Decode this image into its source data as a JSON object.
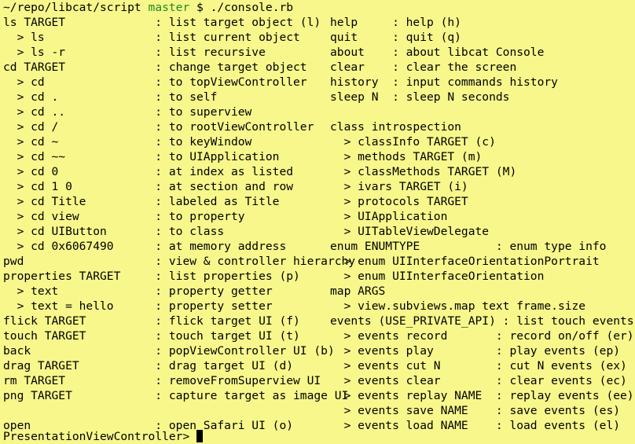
{
  "header": {
    "path": "~/repo/libcat/script",
    "branch": "master",
    "command": "$ ./console.rb"
  },
  "left": {
    "l1": "ls TARGET             : list target object (l)",
    "l2": "  > ls                : list current object",
    "l3": "  > ls -r             : list recursive",
    "l4": "cd TARGET             : change target object",
    "l5": "  > cd                : to topViewController",
    "l6": "  > cd .              : to self",
    "l7": "  > cd ..             : to superview",
    "l8": "  > cd /              : to rootViewController",
    "l9": "  > cd ~              : to keyWindow",
    "l10": "  > cd ~~             : to UIApplication",
    "l11": "  > cd 0              : at index as listed",
    "l12": "  > cd 1 0            : at section and row",
    "l13": "  > cd Title          : labeled as Title",
    "l14": "  > cd view           : to property",
    "l15": "  > cd UIButton       : to class",
    "l16": "  > cd 0x6067490      : at memory address",
    "l17": "pwd                   : view & controller hierarchy",
    "l18": "properties TARGET     : list properties (p)",
    "l19": "  > text              : property getter",
    "l20": "  > text = hello      : property setter",
    "l21": "flick TARGET          : flick target UI (f)",
    "l22": "touch TARGET          : touch target UI (t)",
    "l23": "back                  : popViewController UI (b)",
    "l24": "drag TARGET           : drag target UI (d)",
    "l25": "rm TARGET             : removeFromSuperview UI",
    "l26": "png TARGET            : capture target as image UI",
    "l27": "open                  : open Safari UI (o)"
  },
  "right": {
    "r1": "help     : help (h)",
    "r2": "quit     : quit (q)",
    "r3": "about    : about libcat Console",
    "r4": "clear    : clear the screen",
    "r5": "history  : input commands history",
    "r6": "sleep N  : sleep N seconds",
    "r7": "class introspection",
    "r8": "  > classInfo TARGET (c)",
    "r9": "  > methods TARGET (m)",
    "r10": "  > classMethods TARGET (M)",
    "r11": "  > ivars TARGET (i)",
    "r12": "  > protocols TARGET",
    "r13": "  > UIApplication",
    "r14": "  > UITableViewDelegate",
    "r15": "enum ENUMTYPE           : enum type info",
    "r16": "  > enum UIInterfaceOrientationPortrait",
    "r17": "  > enum UIInterfaceOrientation",
    "r18": "map ARGS",
    "r19": "  > view.subviews.map text frame.size",
    "r20": "events (USE_PRIVATE_API) : list touch events (e)",
    "r21": "  > events record       : record on/off (er)",
    "r22": "  > events play         : play events (ep)",
    "r23": "  > events cut N        : cut N events (ex)",
    "r24": "  > events clear        : clear events (ec)",
    "r25": "  > events replay NAME  : replay events (ee)",
    "r26": "  > events save NAME    : save events (es)",
    "r27": "  > events load NAME    : load events (el)"
  },
  "prompt": {
    "text": "PresentationViewController> "
  },
  "colors": {
    "background": "#f7f78c",
    "text": "#000000",
    "branch": "#1f8a1f",
    "cursor": "#000000"
  }
}
